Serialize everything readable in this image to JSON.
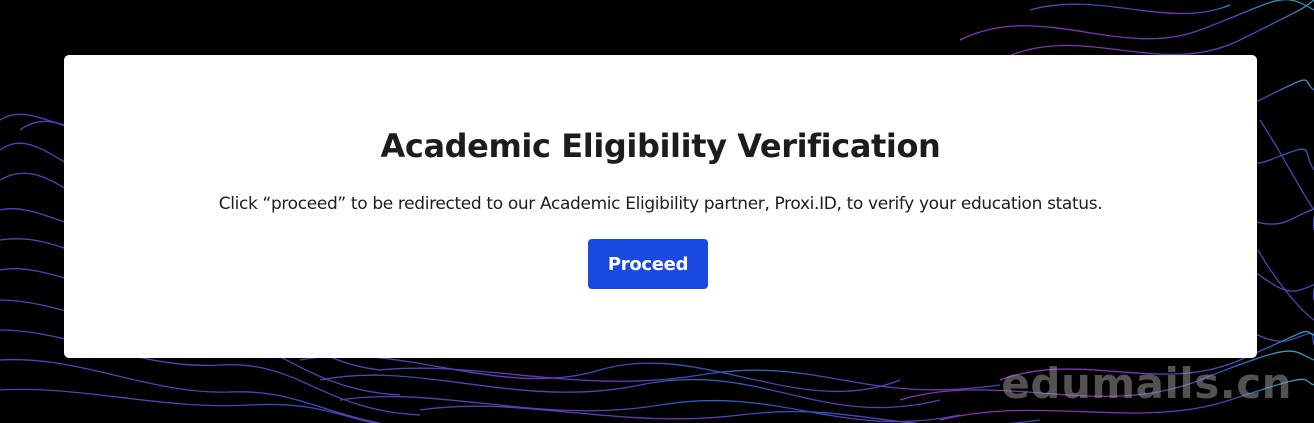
{
  "card": {
    "title": "Academic Eligibility Verification",
    "description": "Click “proceed” to be redirected to our Academic Eligibility partner, Proxi.ID, to verify your education status.",
    "proceed_label": "Proceed"
  },
  "watermark": {
    "text": "edumails.cn"
  },
  "colors": {
    "background": "#000000",
    "card": "#ffffff",
    "button": "#1b4ae3",
    "text": "#1c1c1c",
    "wave_cyan": "#3ec3e0",
    "wave_blue": "#3b5bd9",
    "wave_purple": "#8a3fd6",
    "wave_magenta": "#b03ad0"
  }
}
